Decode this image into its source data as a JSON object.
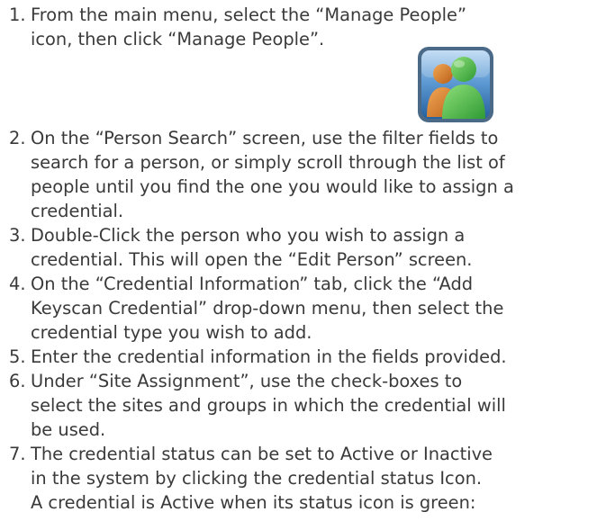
{
  "steps": [
    {
      "number": "1.",
      "lines": [
        "From the main menu, select the “Manage People”",
        "icon, then click “Manage People”."
      ]
    },
    {
      "number": "2.",
      "lines": [
        "On the “Person Search” screen, use the filter fields to",
        "search for a person, or simply scroll through the list of",
        "people until you find the one you would like to assign a",
        "credential."
      ]
    },
    {
      "number": "3.",
      "lines": [
        "Double-Click the person who you wish to assign a",
        "credential.  This will open the “Edit Person” screen."
      ]
    },
    {
      "number": "4.",
      "lines": [
        "On the “Credential Information” tab, click the “Add",
        "Keyscan Credential” drop-down menu, then select the",
        "credential type you wish to add."
      ]
    },
    {
      "number": "5.",
      "lines": [
        "Enter the credential information in the fields provided."
      ]
    },
    {
      "number": "6.",
      "lines": [
        "Under “Site Assignment”, use the check-boxes to",
        "select the sites and groups in which the credential will",
        "be used."
      ]
    },
    {
      "number": "7.",
      "lines": [
        "The credential status can be set to Active or Inactive",
        "in the system by clicking the credential status Icon.",
        "A credential is Active when its status icon is green:"
      ]
    }
  ],
  "manage_people_icon": {
    "icon": "manage-people-icon",
    "colors": {
      "frame": "#4d6e8c",
      "background_top": "#9cc3e8",
      "background_bottom": "#2e6fae",
      "person_back": "#e07f2c",
      "person_front": "#4fc24a"
    }
  }
}
